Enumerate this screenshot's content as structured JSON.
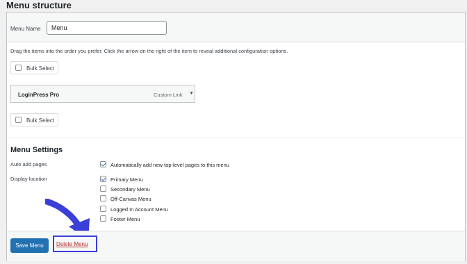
{
  "page_title": "Menu structure",
  "menu_name": {
    "label": "Menu Name",
    "value": "Menu"
  },
  "instructions": "Drag the items into the order you prefer. Click the arrow on the right of the item to reveal additional configuration options.",
  "bulk_select_label": "Bulk Select",
  "menu_item": {
    "title": "LoginPress Pro",
    "type": "Custom Link",
    "arrow": "▼"
  },
  "settings": {
    "title": "Menu Settings",
    "auto_add": {
      "label": "Auto add pages",
      "option": "Automatically add new top-level pages to this menu",
      "checked": true
    },
    "display_location": {
      "label": "Display location",
      "options": [
        {
          "label": "Primary Menu",
          "checked": true
        },
        {
          "label": "Secondary Menu",
          "checked": false
        },
        {
          "label": "Off-Canvas Menu",
          "checked": false
        },
        {
          "label": "Logged In Account Menu",
          "checked": false
        },
        {
          "label": "Footer Menu",
          "checked": false
        }
      ]
    }
  },
  "footer": {
    "save_label": "Save Menu",
    "delete_label": "Delete Menu"
  },
  "colors": {
    "primary": "#2271b1",
    "delete": "#b32d2e",
    "highlight": "#3a3fd8"
  }
}
